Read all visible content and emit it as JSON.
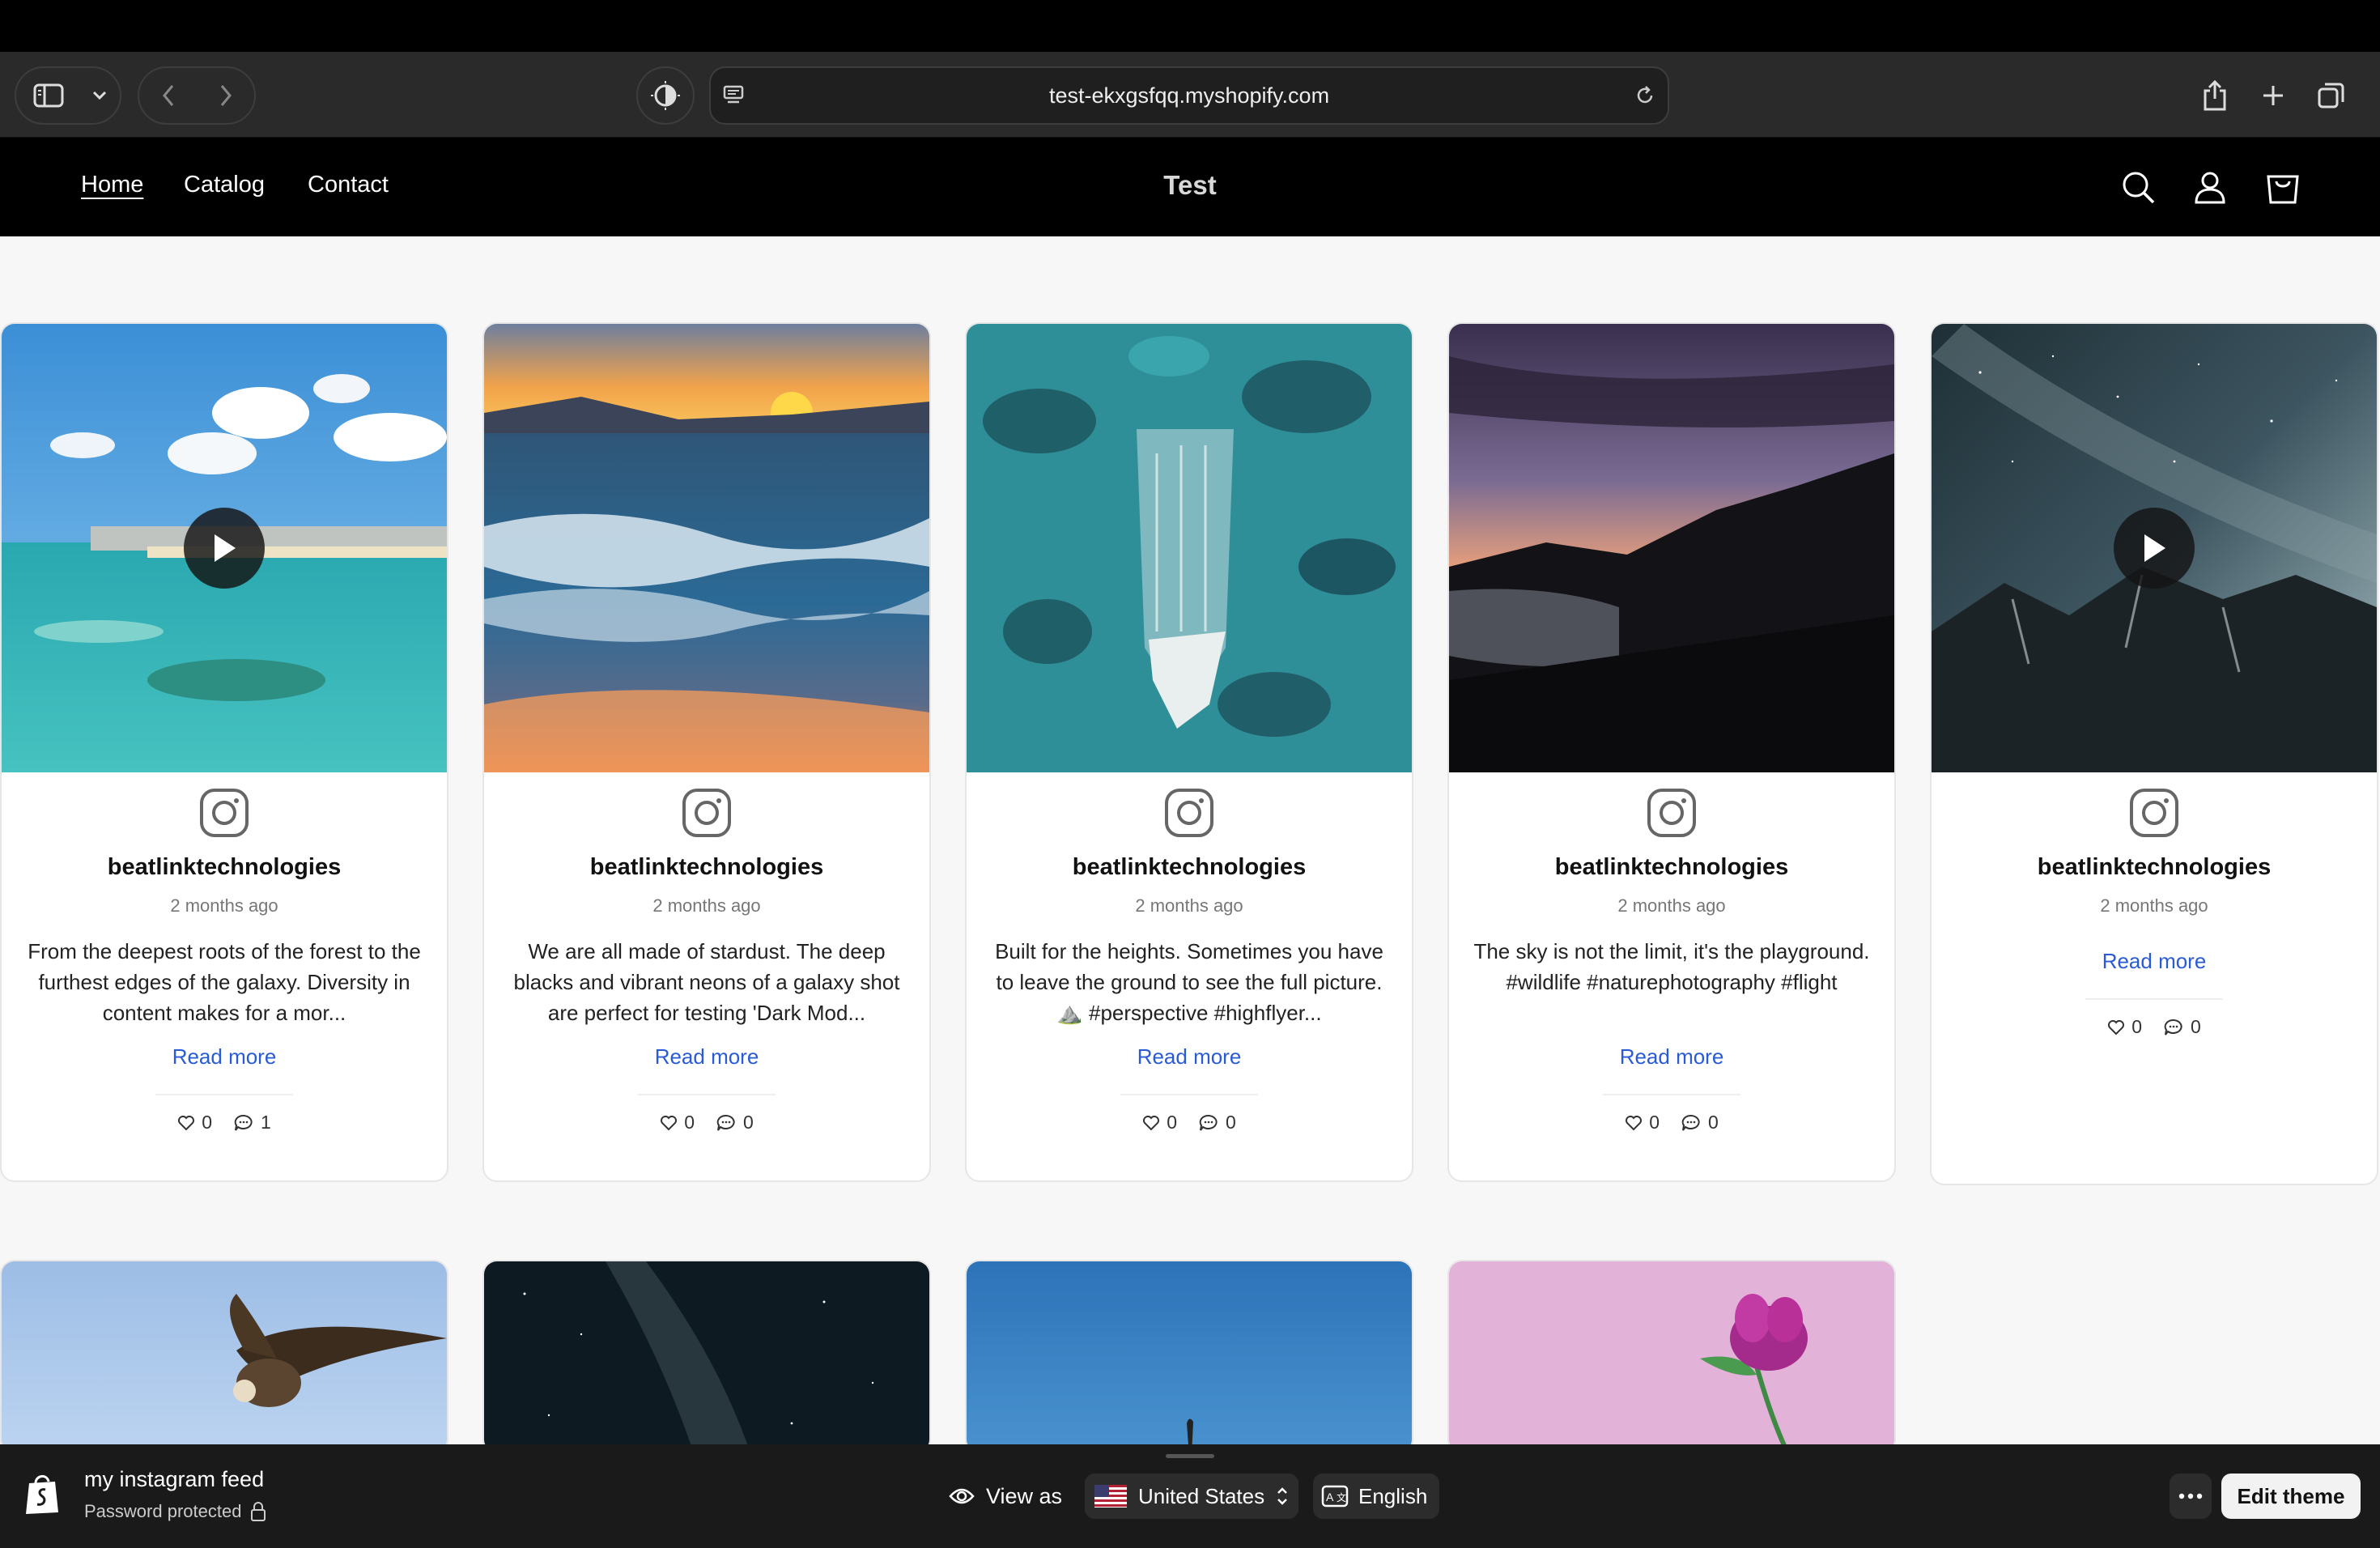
{
  "browser": {
    "url": "test-ekxgsfqq.myshopify.com"
  },
  "nav": {
    "links": [
      "Home",
      "Catalog",
      "Contact"
    ],
    "brand": "Test"
  },
  "posts": [
    {
      "username": "beatlinktechnologies",
      "time": "2 months ago",
      "caption": "From the deepest roots of the forest to the furthest edges of the galaxy. Diversity in content makes for a mor...",
      "read_more": "Read more",
      "likes": "0",
      "comments": "1",
      "video": true
    },
    {
      "username": "beatlinktechnologies",
      "time": "2 months ago",
      "caption": "We are all made of stardust. The deep blacks and vibrant neons of a galaxy shot are perfect for testing 'Dark Mod...",
      "read_more": "Read more",
      "likes": "0",
      "comments": "0",
      "video": false
    },
    {
      "username": "beatlinktechnologies",
      "time": "2 months ago",
      "caption": "Built for the heights. Sometimes you have to leave the ground to see the full picture. ⛰️ #perspective #highflyer...",
      "read_more": "Read more",
      "likes": "0",
      "comments": "0",
      "video": false
    },
    {
      "username": "beatlinktechnologies",
      "time": "2 months ago",
      "caption": "The sky is not the limit, it's the playground. #wildlife #naturephotography #flight",
      "read_more": "Read more",
      "likes": "0",
      "comments": "0",
      "video": false
    },
    {
      "username": "beatlinktechnologies",
      "time": "2 months ago",
      "caption": "",
      "read_more": "Read more",
      "likes": "0",
      "comments": "0",
      "video": true
    }
  ],
  "admin": {
    "store_name": "my instagram feed",
    "status": "Password protected",
    "view_as": "View as",
    "country": "United States",
    "language": "English",
    "edit_theme": "Edit theme"
  },
  "colors": {
    "link": "#2a5bd7",
    "nav_bg": "#000000",
    "page_bg": "#f7f7f7"
  }
}
